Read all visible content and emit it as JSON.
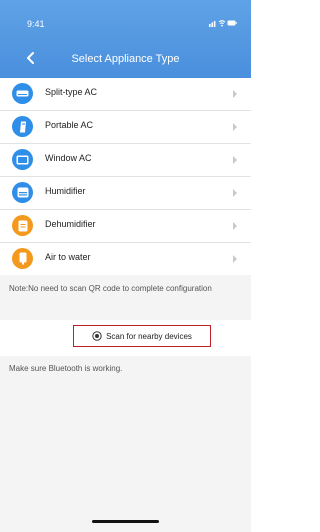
{
  "status_bar": {
    "time": "9:41"
  },
  "header": {
    "title": "Select Appliance Type"
  },
  "appliances": [
    {
      "label": "Split-type AC",
      "icon": "split-ac-icon",
      "color": "#2f8ee8"
    },
    {
      "label": "Portable AC",
      "icon": "portable-ac-icon",
      "color": "#2f8ee8"
    },
    {
      "label": "Window AC",
      "icon": "window-ac-icon",
      "color": "#2f8ee8"
    },
    {
      "label": "Humidifier",
      "icon": "humidifier-icon",
      "color": "#2f8ee8"
    },
    {
      "label": "Dehumidifier",
      "icon": "dehumidifier-icon",
      "color": "#f39a1e"
    },
    {
      "label": "Air to water",
      "icon": "air-to-water-icon",
      "color": "#f39a1e"
    }
  ],
  "note": "Note:No need to scan QR code to complete configuration",
  "scan_button": {
    "label": "Scan for nearby devices",
    "icon": "scan-icon",
    "border_color": "#c0202a"
  },
  "bluetooth_note": "Make sure Bluetooth is working."
}
